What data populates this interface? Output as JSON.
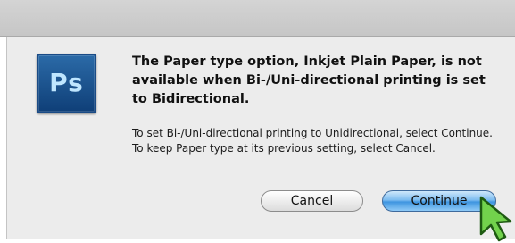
{
  "dialog": {
    "app_icon": {
      "icon": "photoshop-app-icon",
      "label": "Ps",
      "color": "#1e5796"
    },
    "message_title": "The Paper type option, Inkjet Plain Paper, is not available when Bi-/Uni-directional printing is set to Bidirectional.",
    "message_detail": "To set Bi-/Uni-directional printing to Unidirectional, select Continue. To keep Paper type at its previous setting, select Cancel.",
    "buttons": {
      "cancel_label": "Cancel",
      "continue_label": "Continue"
    }
  },
  "pointer": {
    "icon": "arrow-cursor-icon",
    "color": "#6fd04a"
  }
}
